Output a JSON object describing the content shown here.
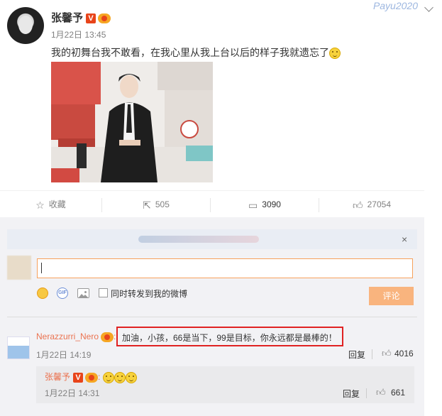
{
  "post": {
    "author": "张馨予",
    "time": "1月22日 13:45",
    "text": "我的初舞台我不敢看，在我心里从我上台以后的样子我就遗忘了",
    "top_right_text": "Payu2020",
    "image_alt": "man in black suit on stage set"
  },
  "actions": {
    "favorite_label": "收藏",
    "repost_count": "505",
    "comment_count": "3090",
    "like_count": "27054"
  },
  "comment_box": {
    "close_label": "×",
    "gif_label": "GIF",
    "also_repost_label": "同时转发到我的微博",
    "submit_label": "评论"
  },
  "comments": [
    {
      "user": "Nerazzurri_Nero",
      "text": "加油，小孩，66是当下，99是目标，你永远都是最棒的！",
      "time": "1月22日 14:19",
      "reply_label": "回复",
      "likes": "4016"
    }
  ],
  "sub_comment": {
    "user": "张馨予",
    "colon": ":",
    "time": "1月22日 14:31",
    "reply_label": "回复",
    "likes": "661"
  },
  "colors": {
    "accent": "#eb7350",
    "input_border": "#f7a15c",
    "submit_bg": "#f9b47e",
    "highlight_box": "#e02222"
  },
  "icons": [
    "star-icon",
    "repost-icon",
    "comment-icon",
    "like-icon",
    "emoji-icon",
    "gif-icon",
    "image-icon",
    "checkbox-icon",
    "close-icon",
    "chevron-down-icon",
    "verified-v-icon",
    "level-icon"
  ]
}
